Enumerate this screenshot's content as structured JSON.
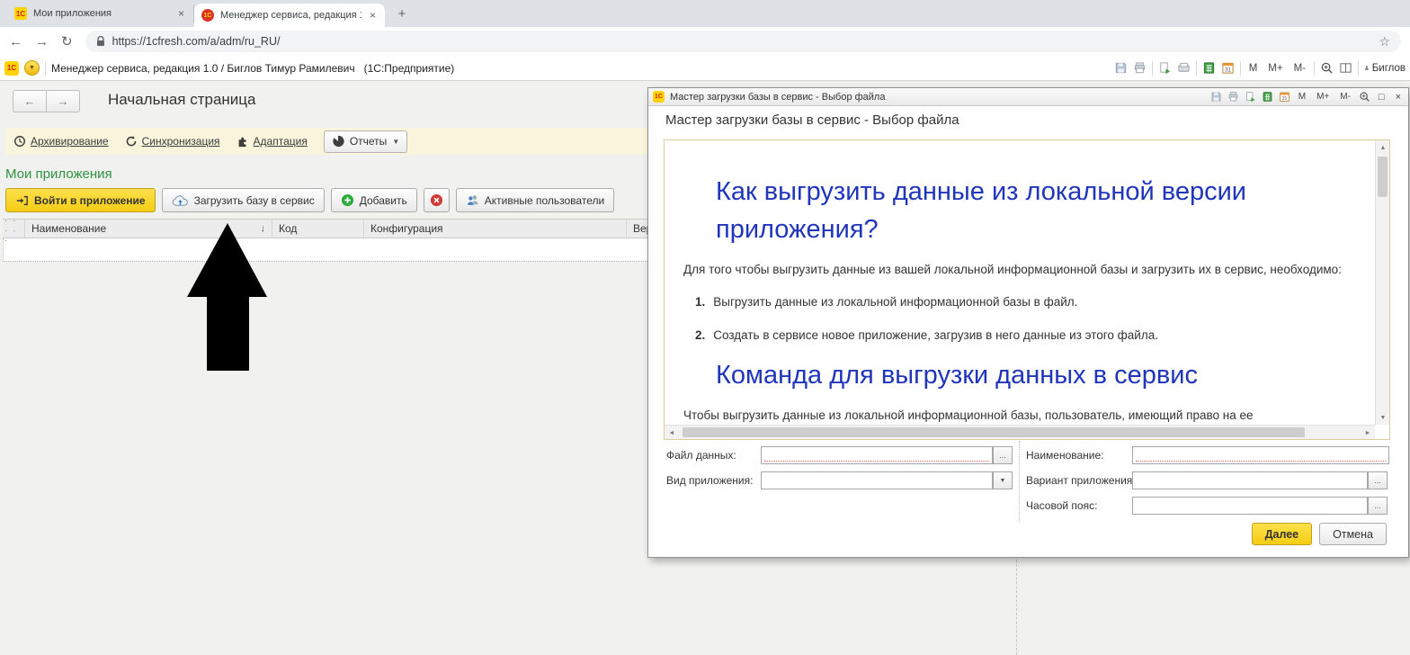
{
  "browser": {
    "tab1": "Мои приложения",
    "tab2": "Менеджер сервиса, редакция 1",
    "new_tab": "+",
    "url": "https://1cfresh.com/a/adm/ru_RU/"
  },
  "app_bar": {
    "title": "Менеджер сервиса, редакция 1.0 / Биглов Тимур Рамилевич   (1С:Предприятие)",
    "m": "M",
    "m_plus": "M+",
    "m_minus": "M-",
    "user": "Биглов"
  },
  "nav": {
    "page_title": "Начальная страница"
  },
  "actionbar": {
    "archive": "Архивирование",
    "sync": "Синхронизация",
    "adapt": "Адаптация",
    "reports": "Отчеты"
  },
  "apps": {
    "section_title": "Мои приложения",
    "login_btn": "Войти в приложение",
    "upload_btn": "Загрузить базу в сервис",
    "add_btn": "Добавить",
    "active_users_btn": "Активные пользователи",
    "col_dots": ". . . . .",
    "col_name": "Наименование",
    "col_code": "Код",
    "col_config": "Конфигурация",
    "col_version": "Версия"
  },
  "dialog": {
    "window_title": "Мастер загрузки базы в сервис - Выбор файла",
    "heading": "Мастер загрузки базы в сервис - Выбор файла",
    "help_h1": "Как выгрузить данные из локальной версии приложения?",
    "help_p1": "Для того чтобы выгрузить данные из вашей локальной информационной базы и загрузить их в сервис, необходимо:",
    "step1_num": "1.",
    "step1": "Выгрузить данные из локальной информационной базы в файл.",
    "step2_num": "2.",
    "step2": "Создать в сервисе новое приложение, загрузив в него данные из этого файла.",
    "help_h2": "Команда для выгрузки данных в сервис",
    "help_p2": "Чтобы выгрузить данные из локальной информационной базы, пользователь, имеющий право на ее",
    "label_file": "Файл данных:",
    "label_kind": "Вид приложения:",
    "label_name": "Наименование:",
    "label_variant": "Вариант приложения:",
    "label_tz": "Часовой пояс:",
    "next_btn": "Далее",
    "cancel_btn": "Отмена"
  },
  "glyphs": {
    "logo": "1С",
    "close": "×",
    "back": "←",
    "forward": "→",
    "reload": "↻",
    "star": "☆",
    "menu_down": "▼",
    "sort_down": "↓",
    "ellipsis": "...",
    "maximize": "□",
    "up": "▲",
    "down": "▼",
    "left": "◄",
    "right": "►",
    "calendar31": "31"
  },
  "colors": {
    "accent_yellow": "#f5cd15",
    "heading_blue": "#1f35bb",
    "section_green": "#2f9240",
    "required_red": "#e86060",
    "actionbar_yellow": "#f8f5dc"
  }
}
